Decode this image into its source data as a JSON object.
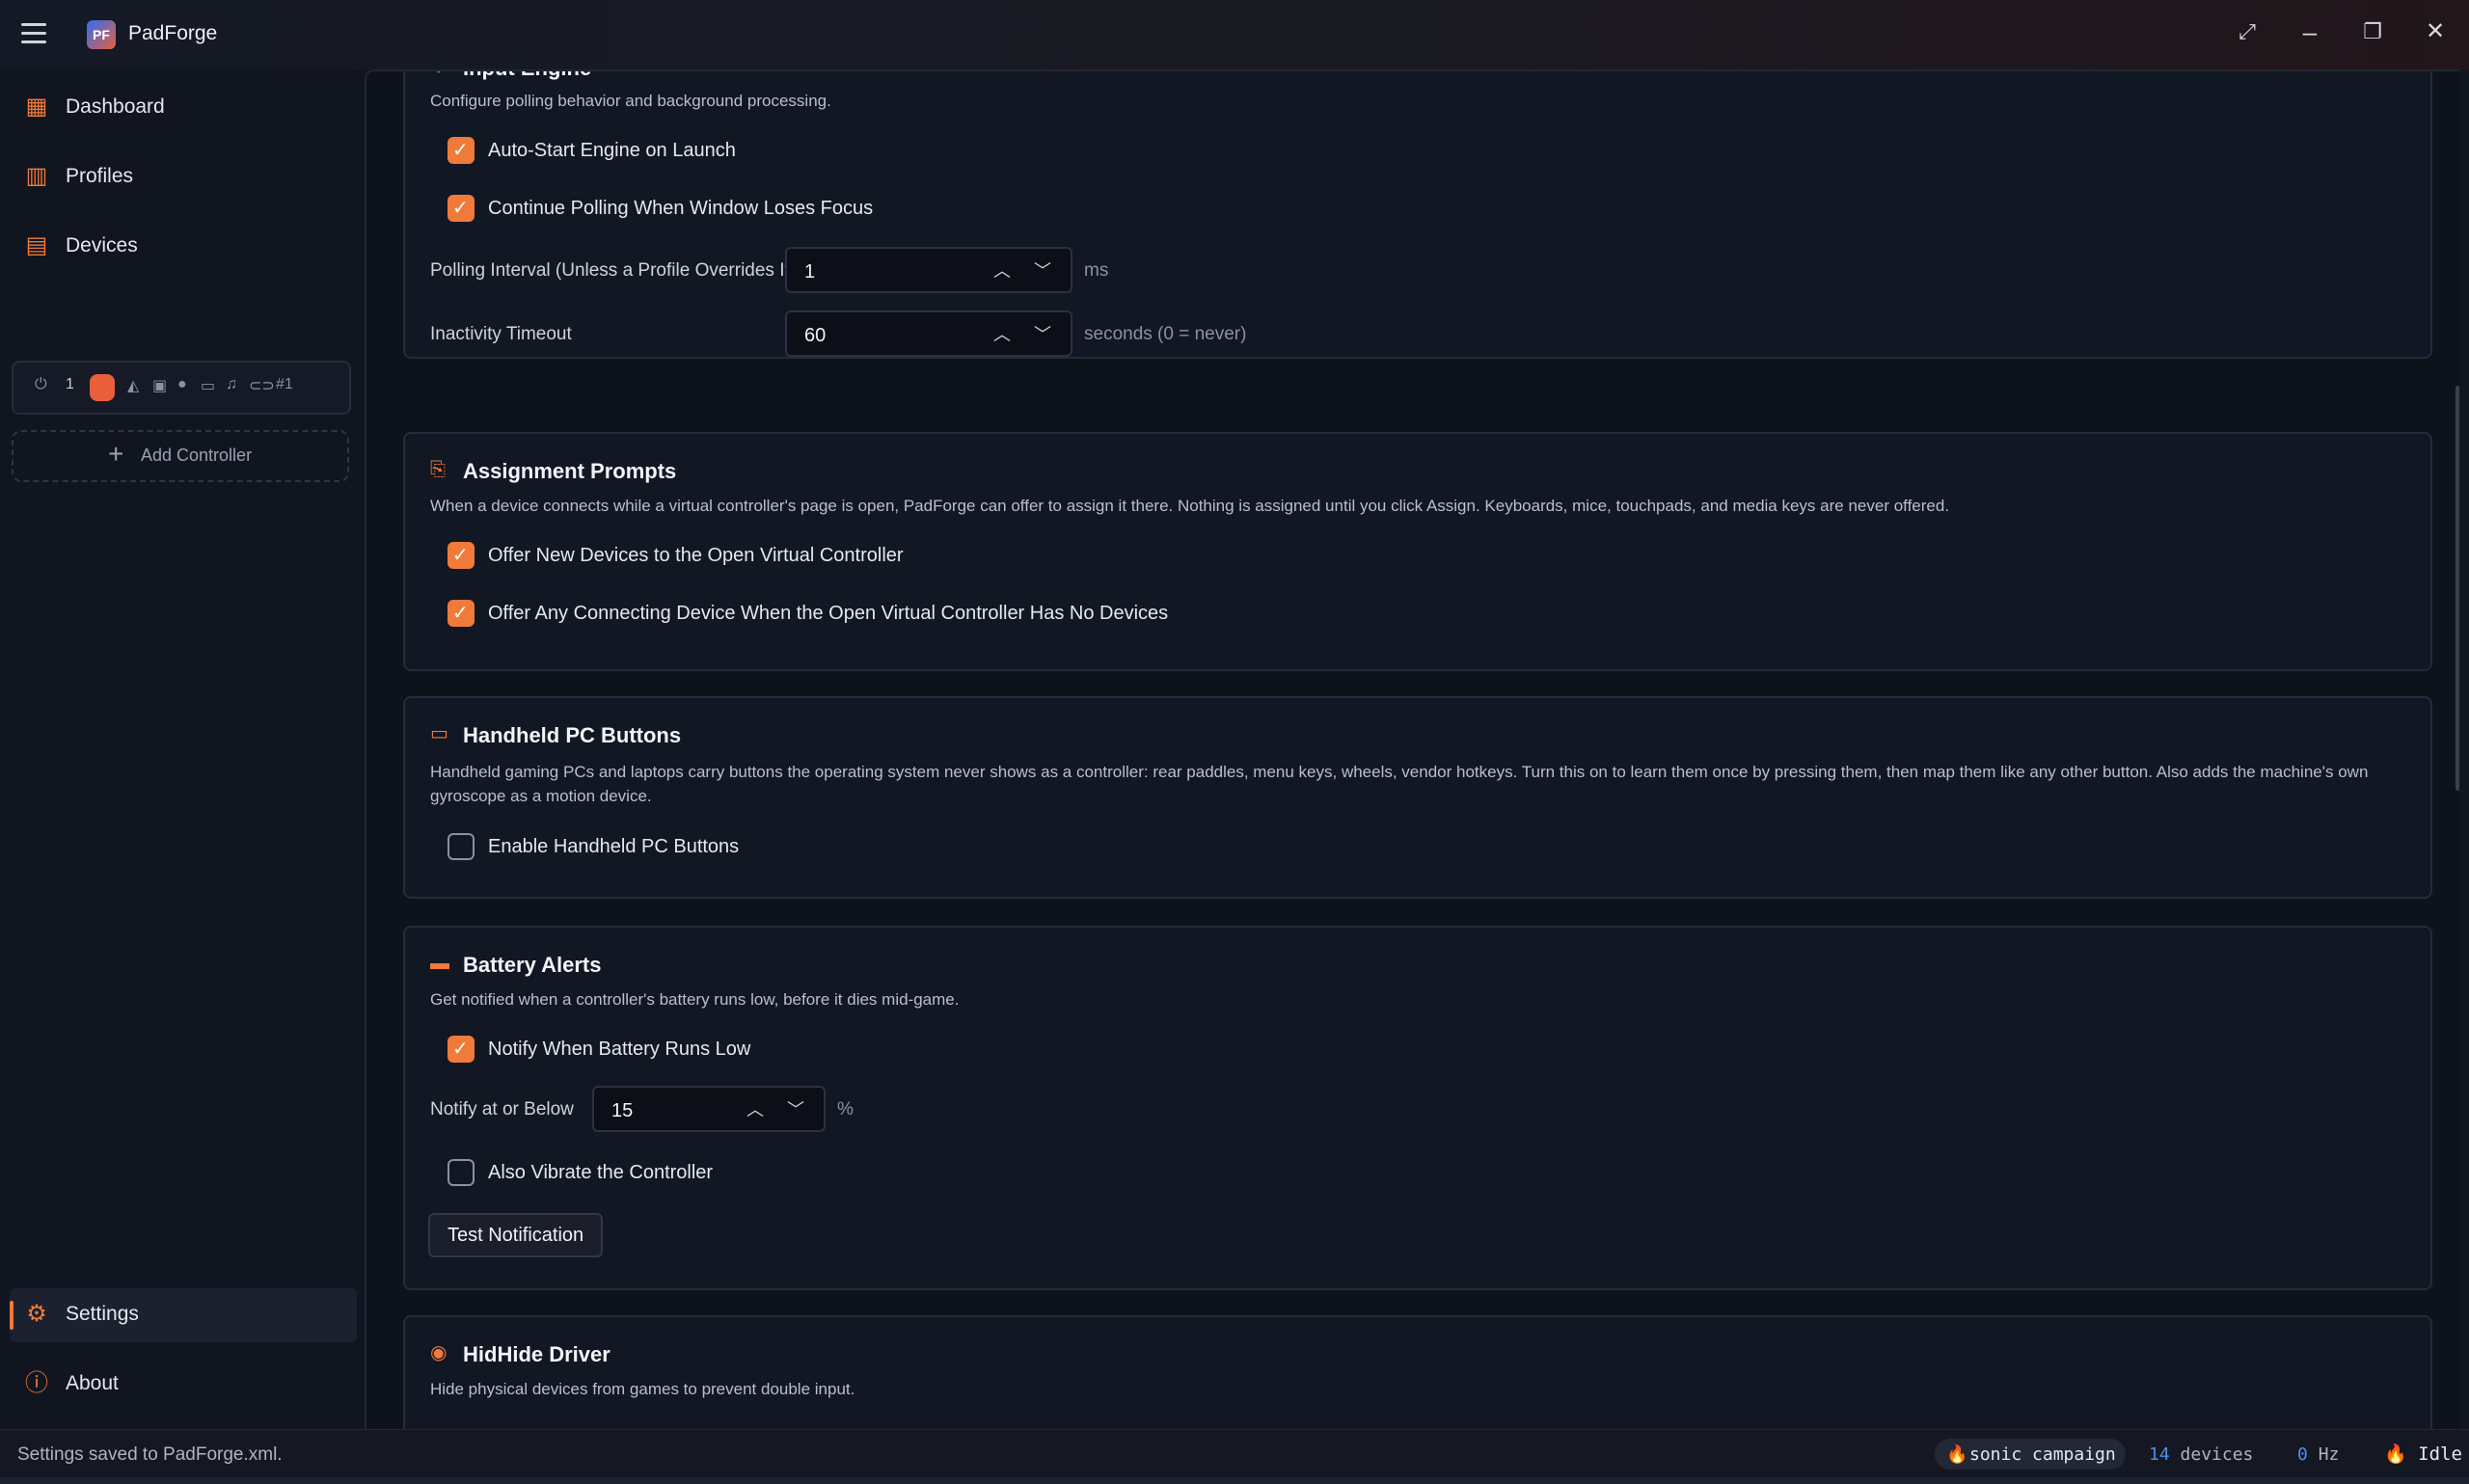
{
  "app": {
    "title": "PadForge",
    "logo_text": "PF"
  },
  "window_controls": {
    "fullscreen": "⤢",
    "minimize": "–",
    "restore": "❐",
    "close": "✕"
  },
  "sidebar": {
    "nav": [
      {
        "label": "Dashboard",
        "icon": "dashboard-icon"
      },
      {
        "label": "Profiles",
        "icon": "profiles-icon"
      },
      {
        "label": "Devices",
        "icon": "devices-icon"
      }
    ],
    "controller_slot": {
      "index": "1",
      "tag": "#1"
    },
    "add_controller": "Add Controller",
    "bottom_nav": [
      {
        "label": "Settings",
        "icon": "gear-icon",
        "active": true
      },
      {
        "label": "About",
        "icon": "info-icon"
      }
    ]
  },
  "sections": {
    "input_engine": {
      "title": "Input Engine",
      "description": "Configure polling behavior and background processing.",
      "auto_start": "Auto-Start Engine on Launch",
      "continue_polling": "Continue Polling When Window Loses Focus",
      "polling_label": "Polling Interval (Unless a Profile Overrides It)",
      "polling_value": "1",
      "polling_unit": "ms",
      "inactivity_label": "Inactivity Timeout",
      "inactivity_value": "60",
      "inactivity_unit": "seconds (0 = never)"
    },
    "assignment": {
      "title": "Assignment Prompts",
      "description": "When a device connects while a virtual controller's page is open, PadForge can offer to assign it there. Nothing is assigned until you click Assign. Keyboards, mice, touchpads, and media keys are never offered.",
      "offer_new": "Offer New Devices to the Open Virtual Controller",
      "offer_any": "Offer Any Connecting Device When the Open Virtual Controller Has No Devices"
    },
    "handheld": {
      "title": "Handheld PC Buttons",
      "description": "Handheld gaming PCs and laptops carry buttons the operating system never shows as a controller: rear paddles, menu keys, wheels, vendor hotkeys. Turn this on to learn them once by pressing them, then map them like any other button. Also adds the machine's own gyroscope as a motion device.",
      "enable": "Enable Handheld PC Buttons"
    },
    "battery": {
      "title": "Battery Alerts",
      "description": "Get notified when a controller's battery runs low, before it dies mid-game.",
      "notify_low": "Notify When Battery Runs Low",
      "threshold_label": "Notify at or Below",
      "threshold_value": "15",
      "threshold_unit": "%",
      "vibrate": "Also Vibrate the Controller",
      "test_button": "Test Notification"
    },
    "hidhide": {
      "title": "HidHide Driver",
      "description": "Hide physical devices from games to prevent double input."
    }
  },
  "statusbar": {
    "message": "Settings saved to PadForge.xml.",
    "profile": "sonic campaign",
    "devices_count": "14",
    "devices_label": "devices",
    "hz_value": "0",
    "hz_label": "Hz",
    "state": "Idle"
  },
  "colors": {
    "accent": "#f07a3a",
    "background": "#111520",
    "card": "#121724"
  }
}
